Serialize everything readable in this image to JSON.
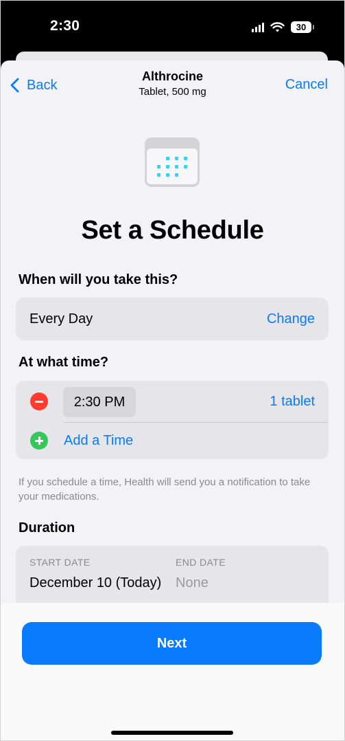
{
  "status_bar": {
    "time": "2:30",
    "battery": "30"
  },
  "nav": {
    "back_label": "Back",
    "title": "Althrocine",
    "subtitle": "Tablet, 500 mg",
    "cancel_label": "Cancel"
  },
  "page_title": "Set a Schedule",
  "frequency": {
    "heading": "When will you take this?",
    "value": "Every Day",
    "change_label": "Change"
  },
  "time_section": {
    "heading": "At what time?",
    "time_value": "2:30 PM",
    "dose": "1 tablet",
    "add_label": "Add a Time"
  },
  "note": "If you schedule a time, Health will send you a notification to take your medications.",
  "duration": {
    "heading": "Duration",
    "start_caption": "START DATE",
    "start_value": "December 10 (Today)",
    "end_caption": "END DATE",
    "end_value": "None"
  },
  "next_label": "Next",
  "colors": {
    "accent": "#0a7aff",
    "remove": "#ff3b30",
    "add": "#34c759",
    "icon_dots": "#3ad1f0"
  }
}
